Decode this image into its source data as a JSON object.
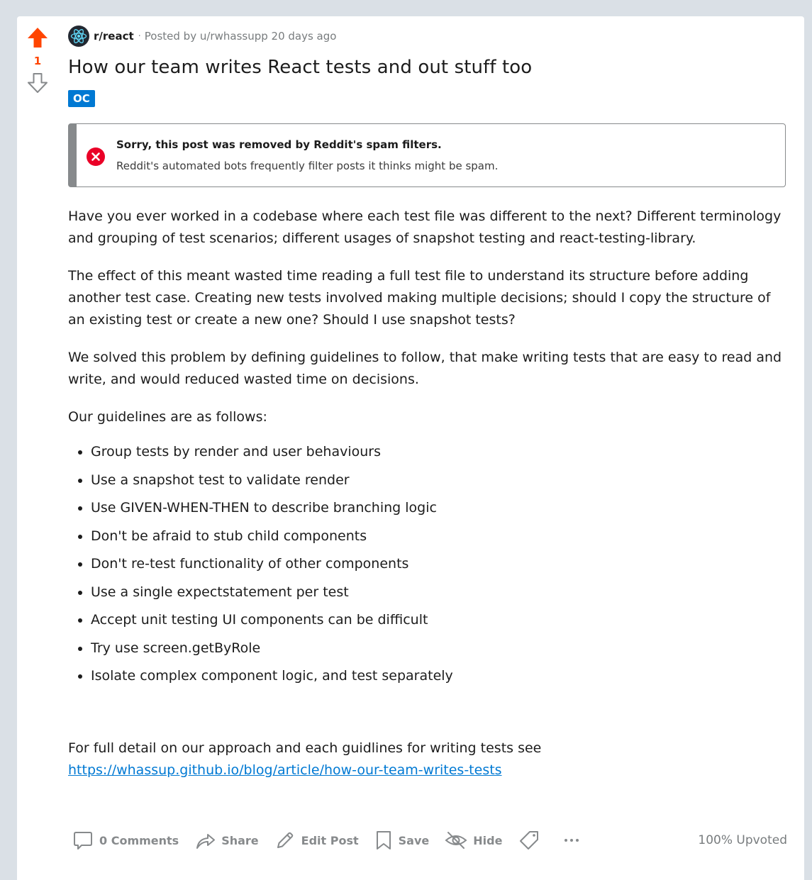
{
  "vote": {
    "score": "1"
  },
  "meta": {
    "subreddit": "r/react",
    "separator": "·",
    "posted_by": "Posted by",
    "user": "u/rwhassupp",
    "time": "20 days ago"
  },
  "post": {
    "title": "How our team writes React tests and out stuff too",
    "flair": "OC"
  },
  "removal": {
    "title": "Sorry, this post was removed by Reddit's spam filters.",
    "text": "Reddit's automated bots frequently filter posts it thinks might be spam."
  },
  "body": {
    "paragraphs": [
      "Have you ever worked in a codebase where each test file was different to the next? Different terminology and grouping of test scenarios; different usages of snapshot testing and react-testing-library.",
      "The effect of this meant wasted time reading a full test file to understand its structure before adding another test case. Creating new tests involved making multiple decisions; should I copy the structure of an existing test or create a new one? Should I use snapshot tests?",
      "We solved this problem by defining guidelines to follow, that make writing tests that are easy to read and write, and would reduced wasted time on decisions.",
      "Our guidelines are as follows:"
    ],
    "guidelines": [
      "Group tests by render and user behaviours",
      "Use a snapshot test to validate render",
      "Use GIVEN-WHEN-THEN to describe branching logic",
      "Don't be afraid to stub child components",
      "Don't re-test functionality of other components",
      "Use a single expectstatement per test",
      "Accept unit testing UI components can be difficult",
      "Try use screen.getByRole",
      "Isolate complex component logic, and test separately"
    ],
    "footer_text": "For full detail on our approach and each guidlines for writing tests see",
    "link": "https://whassup.github.io/blog/article/how-our-team-writes-tests"
  },
  "actions": {
    "comments": "0 Comments",
    "share": "Share",
    "edit": "Edit Post",
    "save": "Save",
    "hide": "Hide",
    "upvoted": "100% Upvoted"
  },
  "colors": {
    "upvote": "#ff4500",
    "flair_bg": "#0079d3",
    "error": "#ea0027",
    "link": "#0079d3",
    "page_bg": "#dae0e6"
  }
}
